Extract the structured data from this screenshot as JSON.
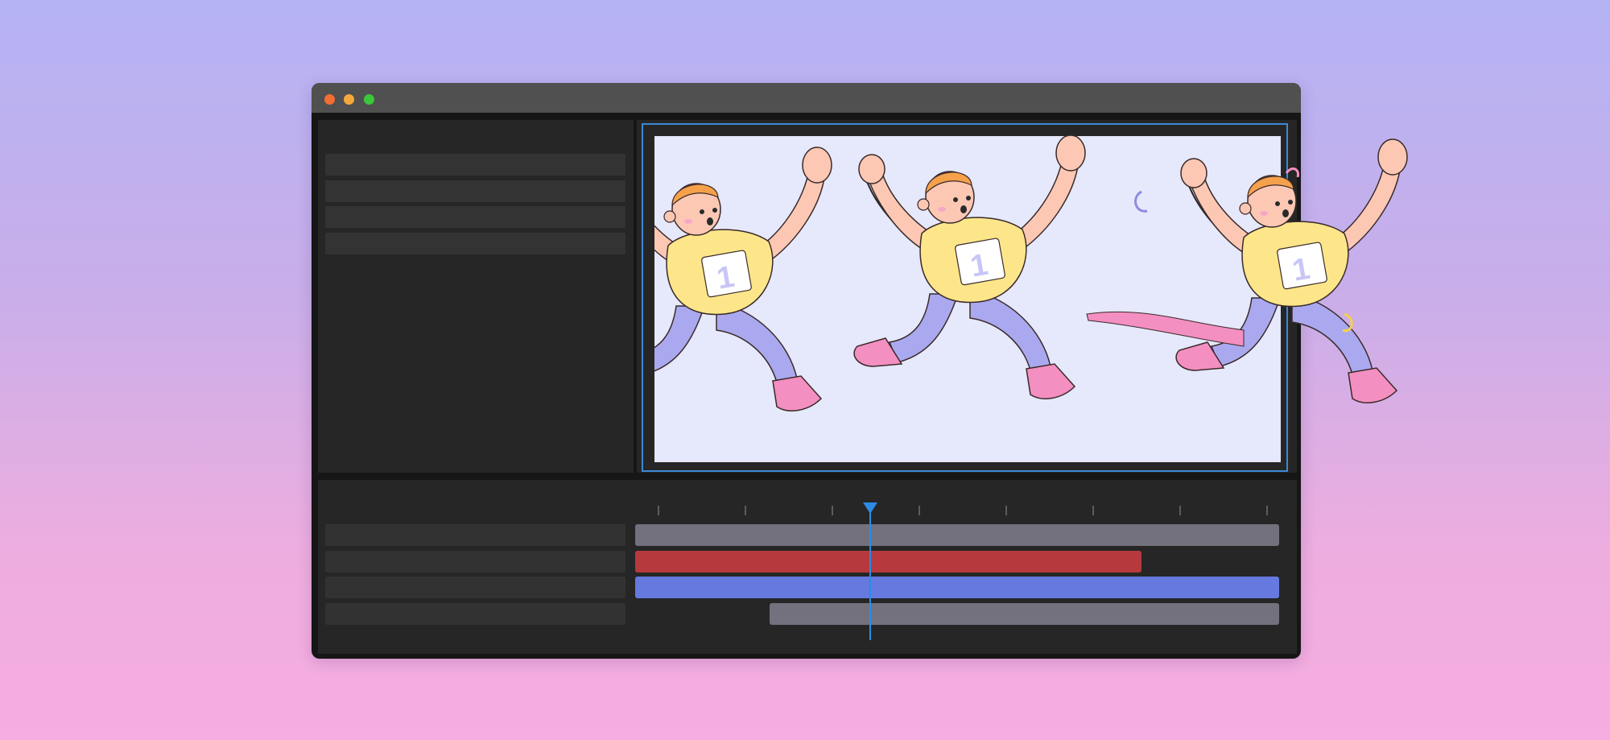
{
  "window": {
    "controls": [
      "close-icon",
      "minimize-icon",
      "maximize-icon"
    ]
  },
  "left_panel": {
    "rows": 4
  },
  "preview": {
    "illustration": "running-characters-image",
    "character_number": "1"
  },
  "timeline": {
    "tick_count": 8,
    "tracks": [
      {
        "name": "track-1",
        "clip_color": "#72717d"
      },
      {
        "name": "track-2",
        "clip_color": "#b63a3d"
      },
      {
        "name": "track-3",
        "clip_color": "#6679df"
      },
      {
        "name": "track-4",
        "clip_color": "#72717d"
      }
    ],
    "playhead_color": "#2d8ae6"
  },
  "colors": {
    "window_bg": "#161616",
    "titlebar": "#505050",
    "panel": "#262626",
    "row": "#333333",
    "selection": "#3b89d6",
    "canvas": "#e6e8fb"
  }
}
